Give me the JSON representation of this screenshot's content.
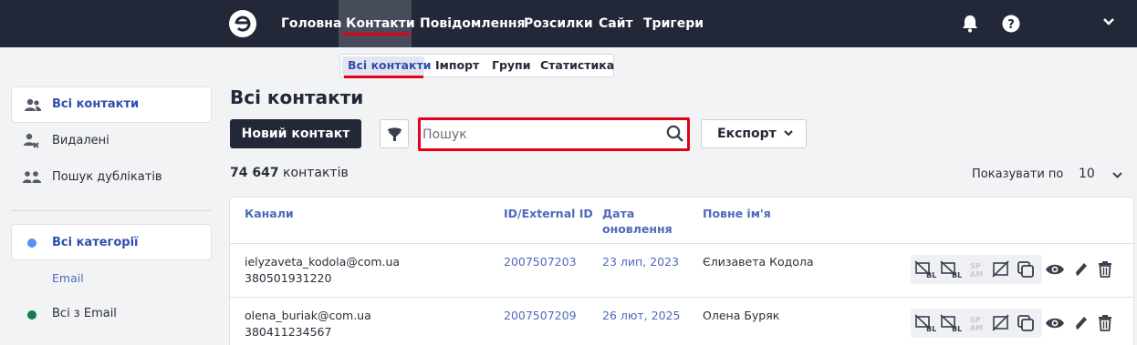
{
  "nav": {
    "items": [
      "Головна",
      "Контакти",
      "Повідомлення",
      "Розсилки",
      "Сайт",
      "Тригери"
    ],
    "active": "Контакти"
  },
  "subnav": {
    "items": [
      "Всі контакти",
      "Імпорт",
      "Групи",
      "Статистика"
    ],
    "active": "Всі контакти"
  },
  "sidebar": {
    "items": [
      "Всі контакти",
      "Видалені",
      "Пошук дублікатів"
    ],
    "categories": {
      "all": "Всі категорії",
      "email_header": "Email",
      "with_email": "Всі з Email"
    }
  },
  "main": {
    "title": "Всі контакти",
    "new_contact_label": "Новий контакт",
    "search_placeholder": "Пошук",
    "export_label": "Експорт",
    "count_number": "74 647",
    "count_suffix": "контактів",
    "per_page_label": "Показувати по",
    "per_page_value": "10"
  },
  "table": {
    "headers": {
      "channels": "Канали",
      "id": "ID/External ID",
      "date_l1": "Дата",
      "date_l2": "оновлення",
      "name": "Повне ім'я"
    },
    "rows": [
      {
        "email": "ielyzaveta_kodola@com.ua",
        "phone": "380501931220",
        "id": "2007507203",
        "date": "23 лип, 2023",
        "name": "Єлизавета Кодола"
      },
      {
        "email": "olena_buriak@com.ua",
        "phone": "380411234567",
        "id": "2007507209",
        "date": "26 лют, 2025",
        "name": "Олена Буряк"
      }
    ]
  },
  "icons": {
    "bl": "BL",
    "spam_l1": "SP",
    "spam_l2": "AM"
  },
  "colors": {
    "topbar": "#232838",
    "accent_red": "#e3001b",
    "link_blue": "#4e6abb",
    "active_blue": "#2e4fb0",
    "dot_blue": "#5a8ef0",
    "dot_green": "#1a7a4c"
  }
}
